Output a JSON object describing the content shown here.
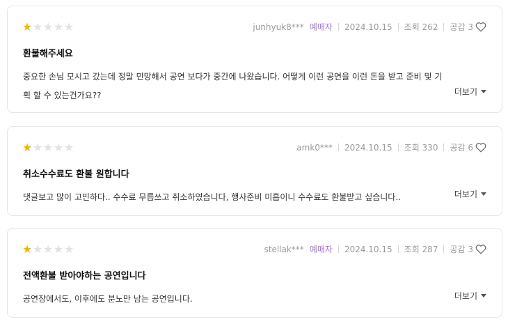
{
  "reviews": [
    {
      "rating": 1,
      "user": "junhyuk8***",
      "badge": "예매자",
      "date": "2024.10.15",
      "views": "조회 262",
      "likes": "공감 3",
      "title": "환불해주세요",
      "content": "중요한 손님 모시고 갔는데 정말 민망해서 공연 보다가 중간에 나왔습니다. 어떻게 이런 공연을 이런 돈을 받고 준비 및 기획 할 수 있는건가요??",
      "more": "더보기"
    },
    {
      "rating": 1,
      "user": "amk0***",
      "badge": "",
      "date": "2024.10.15",
      "views": "조회 330",
      "likes": "공감 6",
      "title": "취소수수료도 환불 원합니다",
      "content": "댓글보고 많이 고민하다.. 수수료 무릅쓰고 취소하였습니다, 행사준비 미흡이니 수수료도 환불받고 싶습니다..",
      "more": "더보기"
    },
    {
      "rating": 1,
      "user": "stellak***",
      "badge": "예매자",
      "date": "2024.10.15",
      "views": "조회 287",
      "likes": "공감 3",
      "title": "전액환불 받아야하는 공연입니다",
      "content": "공연장에서도, 이후에도 분노만 남는 공연입니다.",
      "more": "더보기"
    }
  ],
  "max_rating": 5,
  "colors": {
    "star_on": "#f5b400",
    "star_off": "#e2e2e2",
    "badge": "#a86fe0"
  },
  "icons": {
    "star": "star-icon",
    "like": "heart-icon",
    "more": "caret-down-icon"
  }
}
